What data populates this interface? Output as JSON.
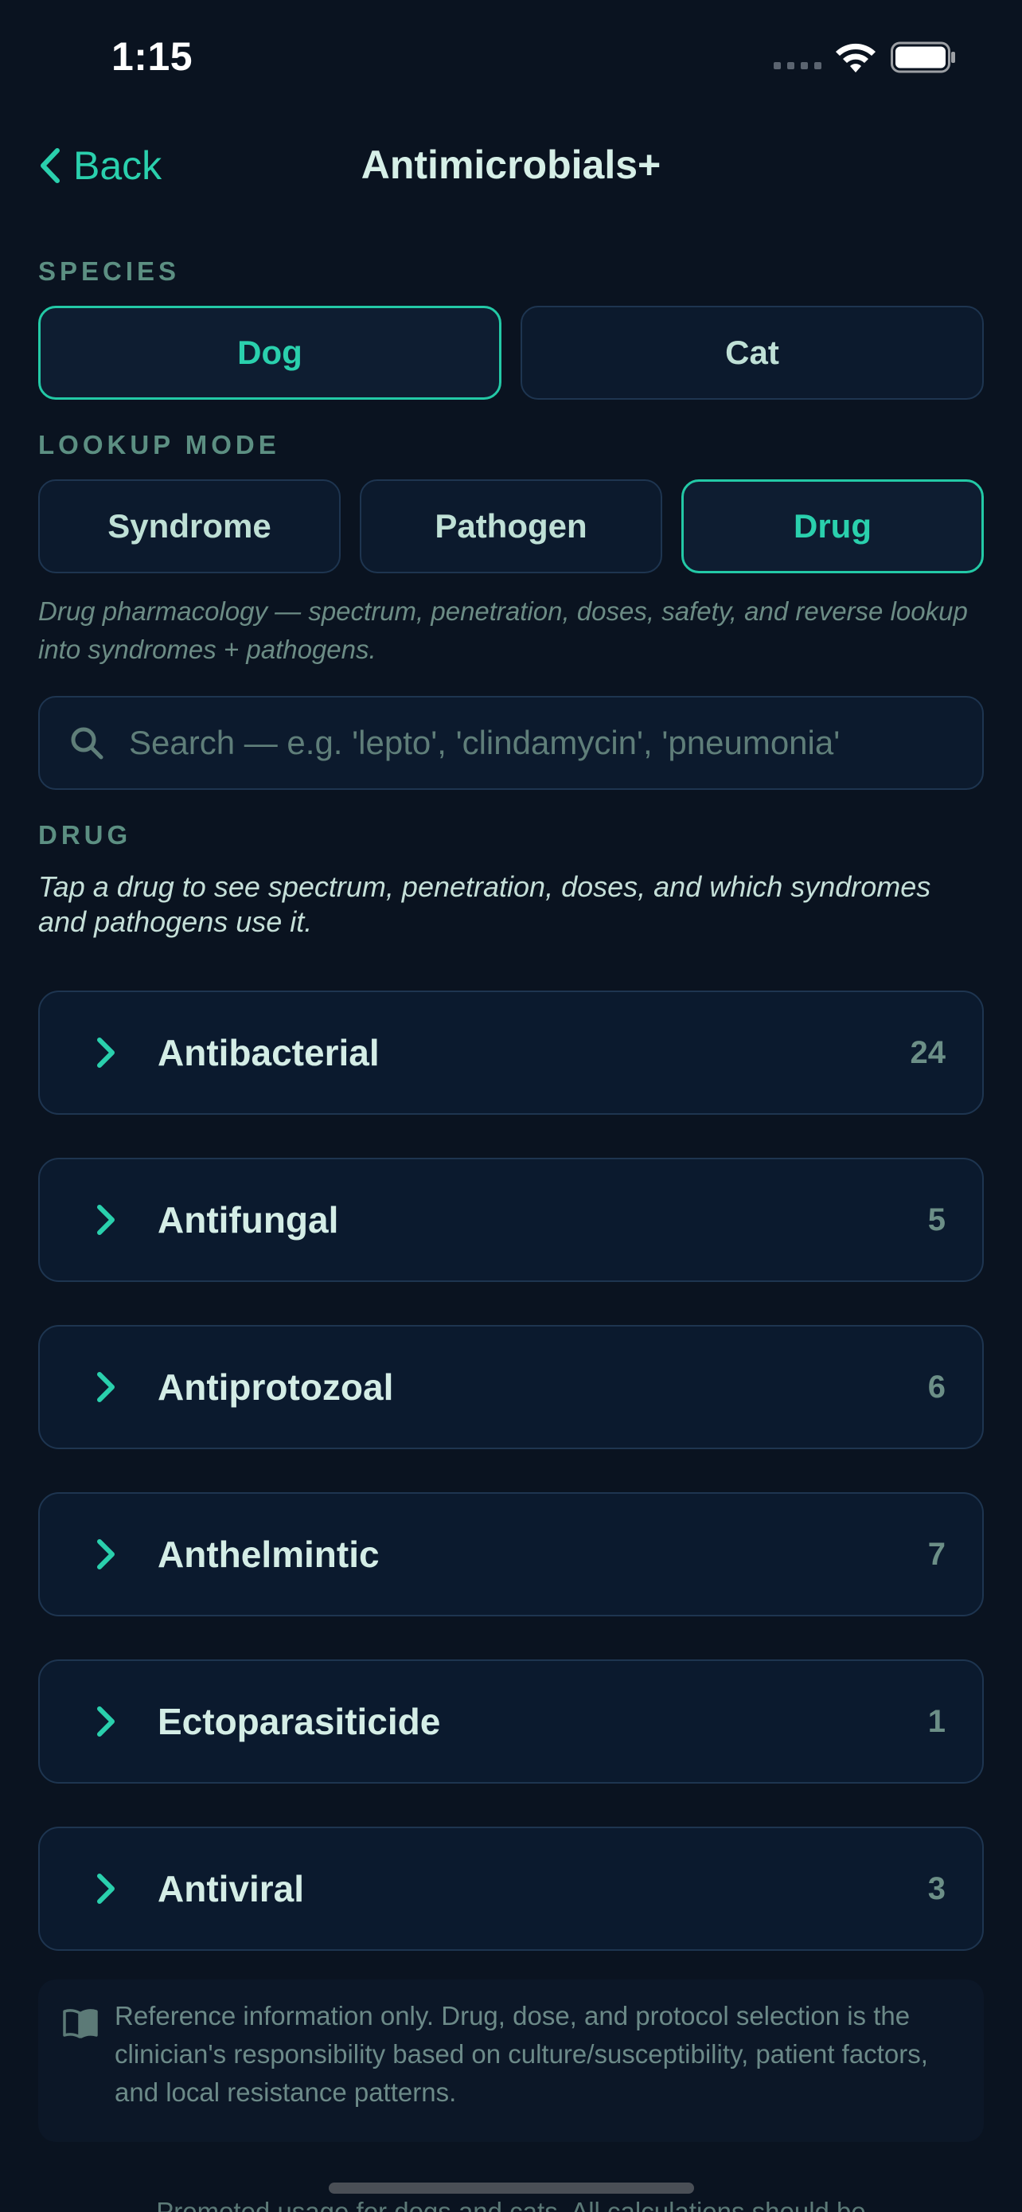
{
  "status_bar": {
    "time": "1:15"
  },
  "nav": {
    "back_label": "Back",
    "title": "Antimicrobials+"
  },
  "species": {
    "label": "SPECIES",
    "options": [
      "Dog",
      "Cat"
    ],
    "selected": "Dog"
  },
  "lookup_mode": {
    "label": "LOOKUP MODE",
    "options": [
      "Syndrome",
      "Pathogen",
      "Drug"
    ],
    "selected": "Drug",
    "description": "Drug pharmacology — spectrum, penetration, doses, safety, and reverse lookup into syndromes + pathogens."
  },
  "search": {
    "placeholder": "Search — e.g. 'lepto', 'clindamycin', 'pneumonia'",
    "value": ""
  },
  "drug_section": {
    "label": "DRUG",
    "hint": "Tap a drug to see spectrum, penetration, doses, and which syndromes and pathogens use it.",
    "categories": [
      {
        "name": "Antibacterial",
        "count": "24"
      },
      {
        "name": "Antifungal",
        "count": "5"
      },
      {
        "name": "Antiprotozoal",
        "count": "6"
      },
      {
        "name": "Anthelmintic",
        "count": "7"
      },
      {
        "name": "Ectoparasiticide",
        "count": "1"
      },
      {
        "name": "Antiviral",
        "count": "3"
      }
    ]
  },
  "disclaimer": {
    "icon": "book-open-icon",
    "text": "Reference information only. Drug, dose, and protocol selection is the clinician's responsibility based on culture/susceptibility, patient factors, and local resistance patterns."
  },
  "footer": {
    "text": "Promoted usage for dogs and cats. All calculations should be"
  },
  "colors": {
    "background": "#0a1320",
    "accent": "#2ad0ad",
    "card": "#0b1a2e",
    "border": "#1e3550"
  }
}
